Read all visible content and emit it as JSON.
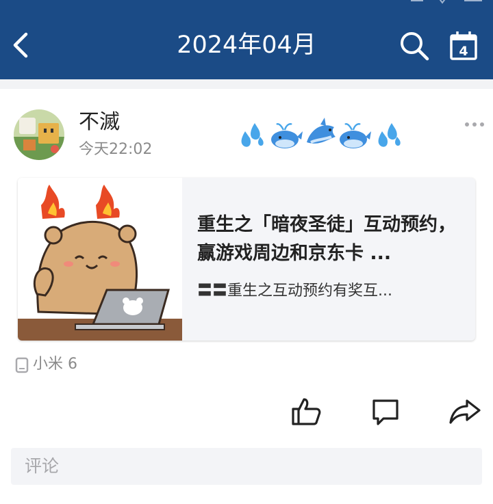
{
  "header": {
    "title": "2024年04月",
    "bg_color": "#1b4b86",
    "back_icon": "chevron-left-icon",
    "search_icon": "search-icon",
    "calendar_icon": "calendar-icon",
    "calendar_day": "4"
  },
  "post": {
    "username": "不滅",
    "time": "今天22:02",
    "signature_emojis": [
      "sweat-droplets",
      "whale",
      "dolphin",
      "whale",
      "sweat-droplets"
    ],
    "more_icon": "more-dots-icon",
    "card": {
      "title": "重生之「暗夜圣徒」互动预约，赢游戏周边和京东卡 ...",
      "subtitle": "〓〓重生之互动预约有奖互..."
    },
    "device": {
      "label": "小米 6",
      "icon": "phone-icon"
    },
    "actions": [
      "thumbs-up-icon",
      "comment-icon",
      "share-icon"
    ],
    "comment_placeholder": "评论"
  }
}
